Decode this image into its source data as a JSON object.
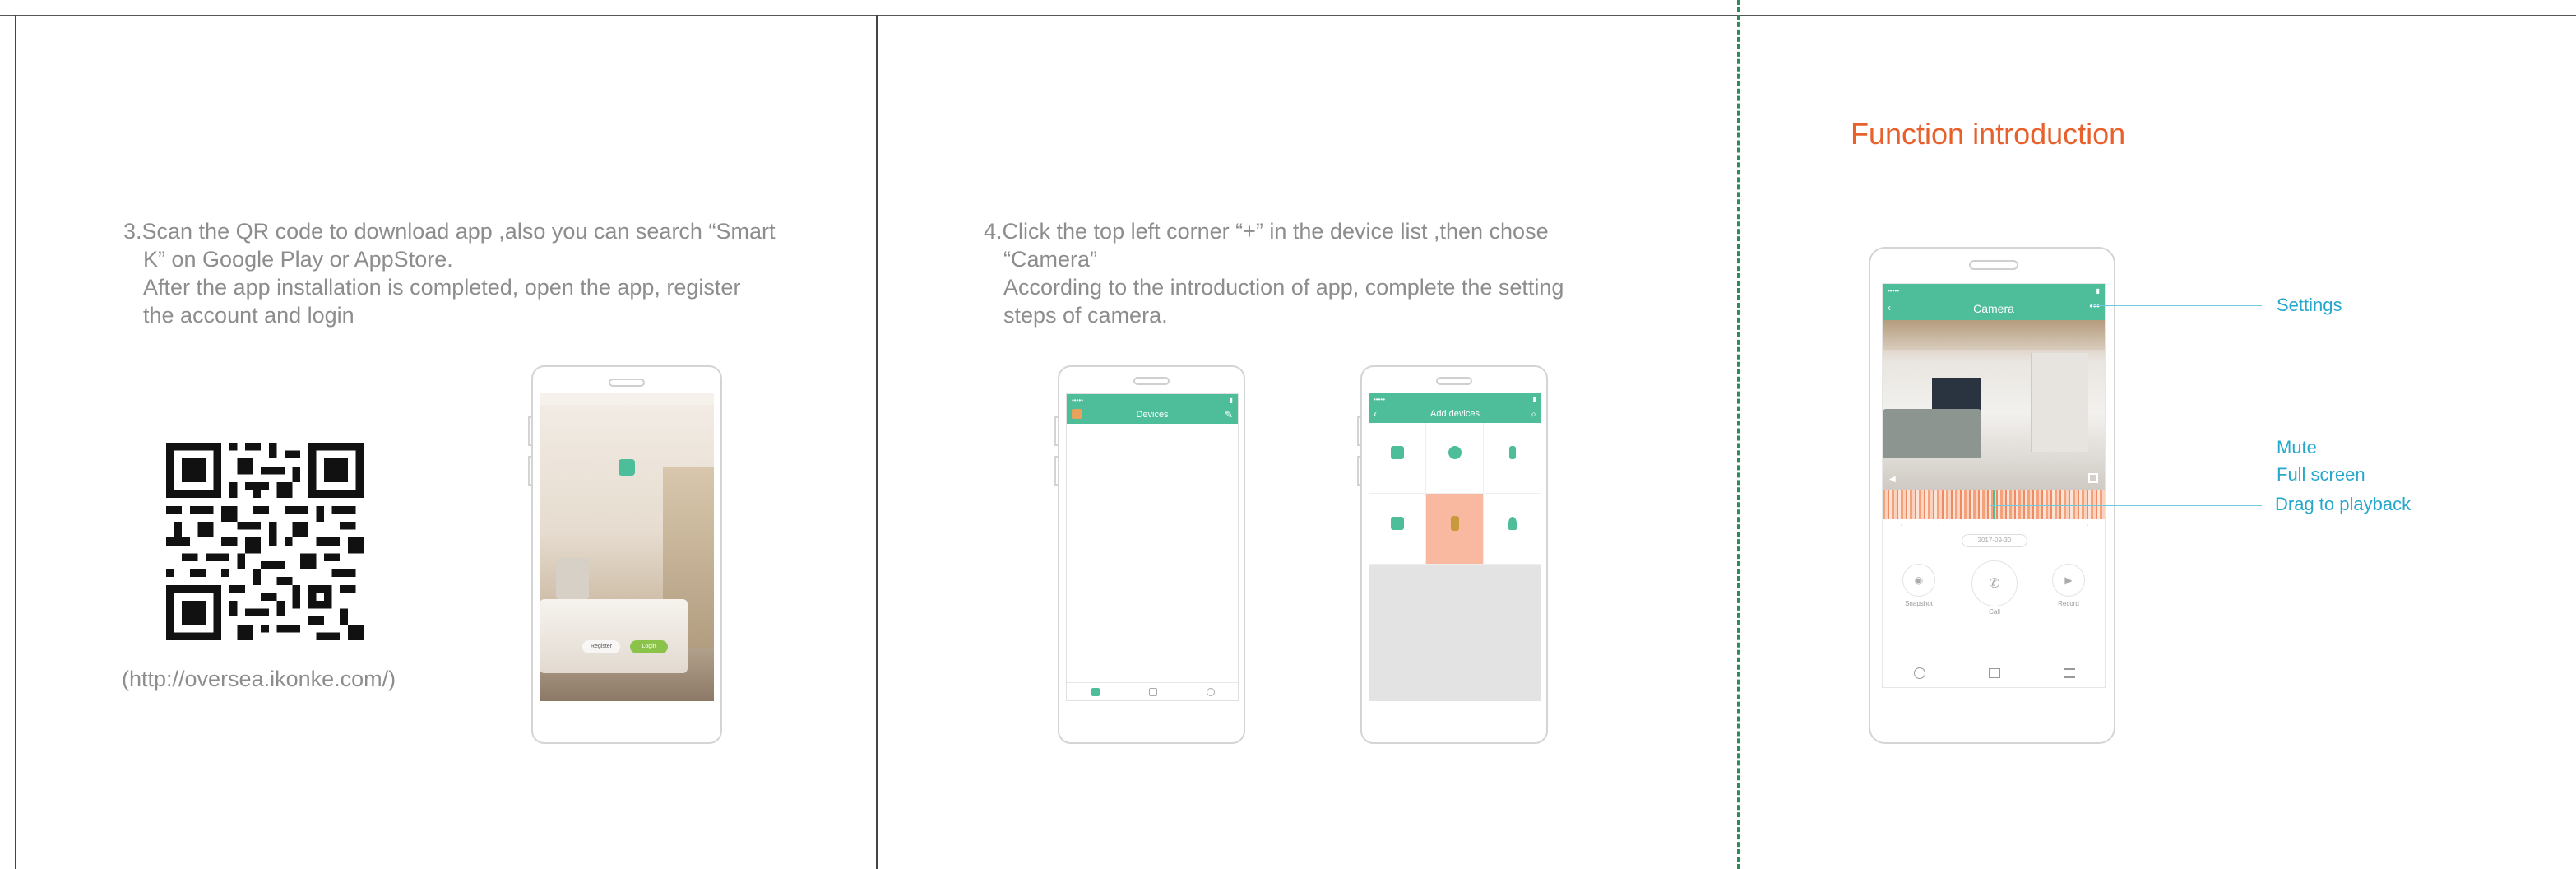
{
  "step3": {
    "line1": "3.Scan the QR code to download app ,also you can search “Smart",
    "line2": "K” on Google Play or AppStore.",
    "line3": "After the app installation is completed, open the app, register",
    "line4": "the account and login",
    "url": "(http://oversea.ikonke.com/)"
  },
  "step4": {
    "line1": "4.Click the top left corner “+” in the device list ,then chose",
    "line2": "“Camera”",
    "line3": "According to the introduction of app, complete the setting",
    "line4": "steps of camera."
  },
  "phone_login": {
    "login_btn": "Login",
    "register_btn": "Register"
  },
  "phone_devices": {
    "title": "Devices"
  },
  "phone_add": {
    "title": "Add devices"
  },
  "function": {
    "title": "Function introduction",
    "camera_title": "Camera",
    "date": "2017-09-30",
    "snapshot": "Snapshot",
    "call": "Call",
    "record": "Record",
    "callouts": {
      "settings": "Settings",
      "mute": "Mute",
      "full_screen": "Full screen",
      "drag": "Drag to playback"
    }
  },
  "colors": {
    "accent_green": "#4dbd9a",
    "title_orange": "#e8612c",
    "callout_blue": "#27a7cc"
  }
}
